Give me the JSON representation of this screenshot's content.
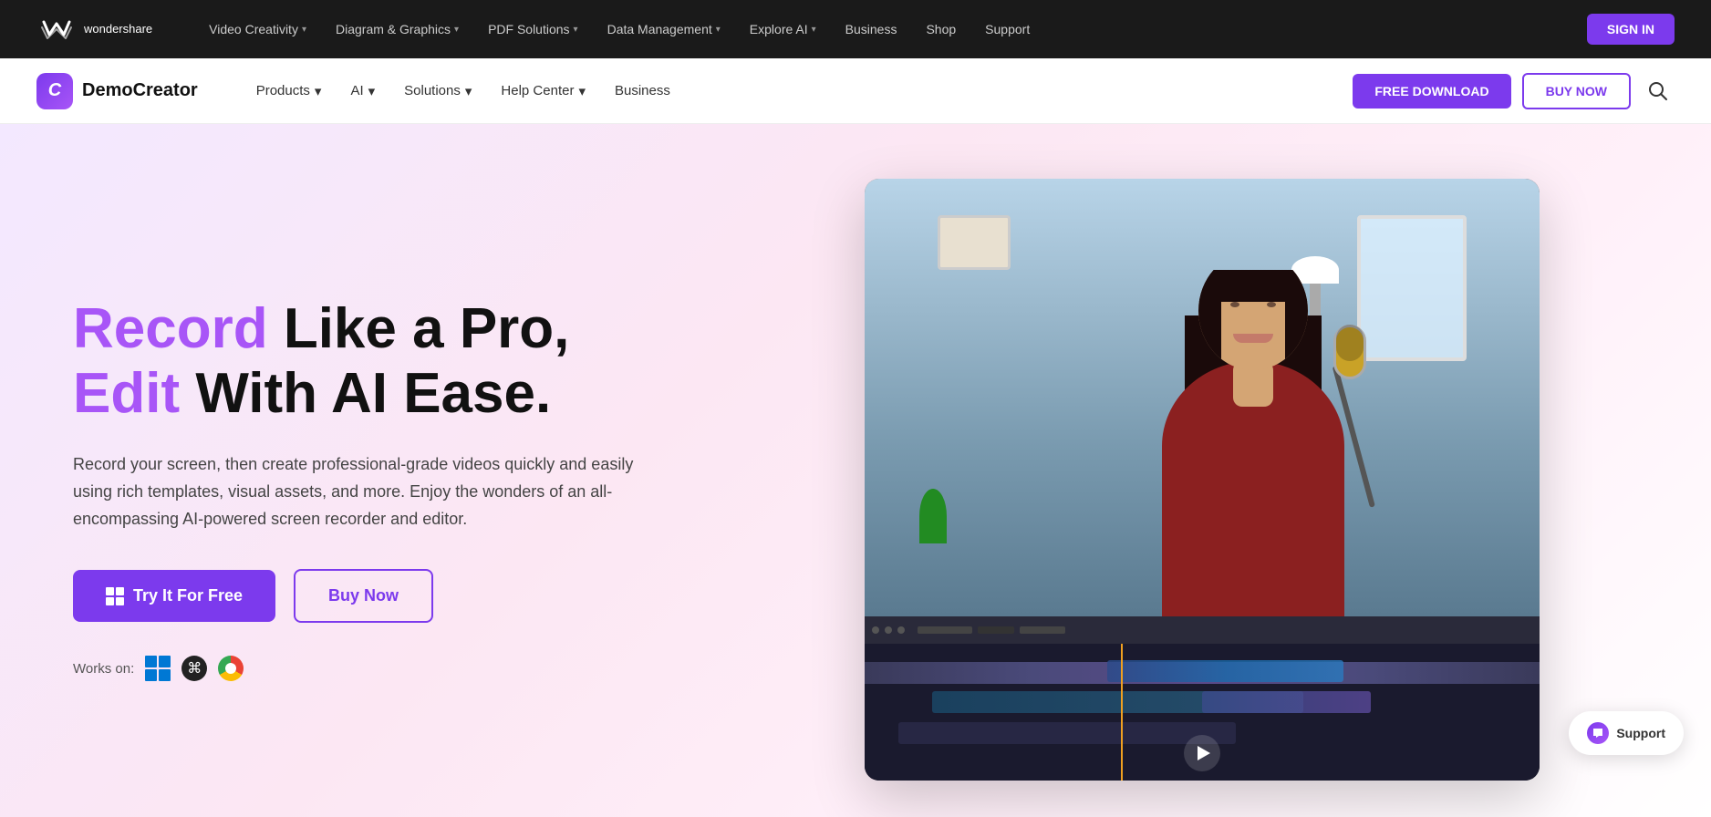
{
  "topNav": {
    "brand": "wondershare",
    "items": [
      {
        "label": "Video Creativity",
        "hasDropdown": true
      },
      {
        "label": "Diagram & Graphics",
        "hasDropdown": true
      },
      {
        "label": "PDF Solutions",
        "hasDropdown": true
      },
      {
        "label": "Data Management",
        "hasDropdown": true
      },
      {
        "label": "Explore AI",
        "hasDropdown": true
      },
      {
        "label": "Business",
        "hasDropdown": false
      },
      {
        "label": "Shop",
        "hasDropdown": false
      },
      {
        "label": "Support",
        "hasDropdown": false
      }
    ],
    "signin": "SIGN IN"
  },
  "productNav": {
    "productName": "DemoCreator",
    "items": [
      {
        "label": "Products",
        "hasDropdown": true
      },
      {
        "label": "AI",
        "hasDropdown": true
      },
      {
        "label": "Solutions",
        "hasDropdown": true
      },
      {
        "label": "Help Center",
        "hasDropdown": true
      },
      {
        "label": "Business",
        "hasDropdown": false
      }
    ],
    "freeDownload": "FREE DOWNLOAD",
    "buyNow": "BUY NOW"
  },
  "hero": {
    "titlePart1": "Record",
    "titlePart2": " Like a Pro,",
    "titlePart3": "Edit",
    "titlePart4": " With AI Ease.",
    "description": "Record your screen, then create professional-grade videos quickly and easily using rich templates, visual assets, and more. Enjoy the wonders of an all-encompassing AI-powered screen recorder and editor.",
    "tryFreeBtn": "Try It For Free",
    "buyNowBtn": "Buy Now",
    "worksOn": "Works on:",
    "supportBtn": "Support"
  }
}
